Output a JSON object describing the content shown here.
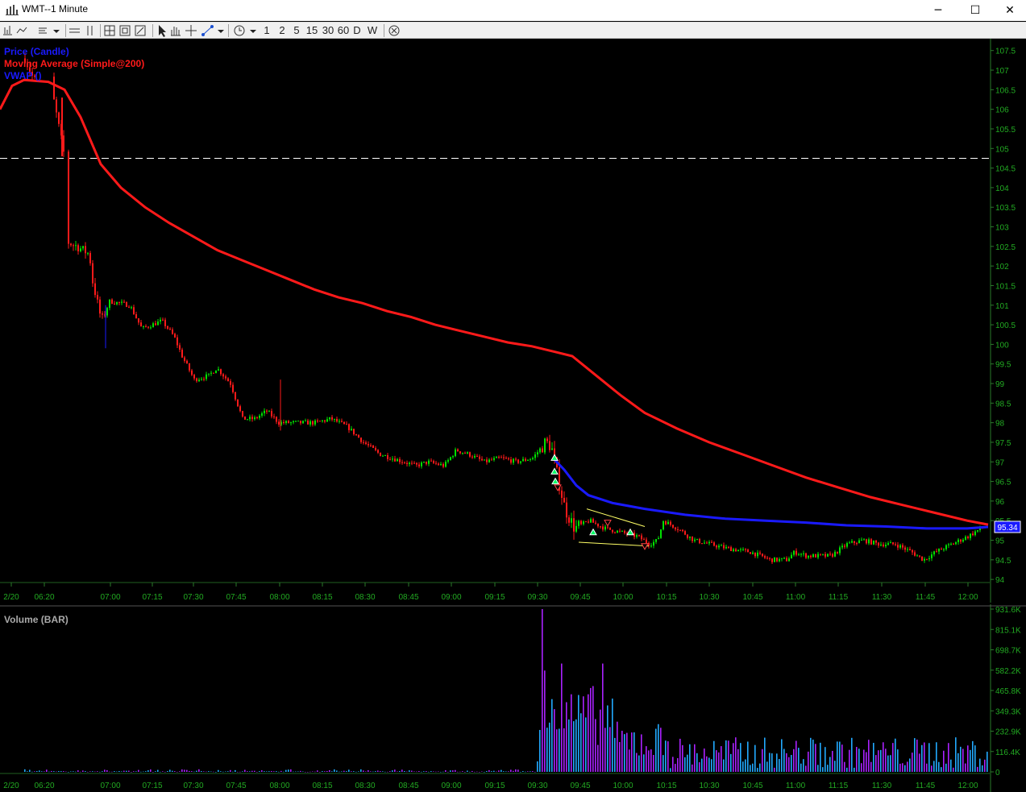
{
  "window": {
    "title": "WMT--1 Minute",
    "buttons": {
      "minimize": "─",
      "maximize": "☐",
      "close": "✕"
    }
  },
  "toolbar": {
    "icons": [
      "bar-chart-icon",
      "line-chart-icon",
      "style-icon",
      "dropdown-icon",
      "hline-icon",
      "vline-icon",
      "crosshair-box-icon",
      "zoom-box-icon",
      "zoom-fit-icon",
      "pointer-icon",
      "hand-icon",
      "crosshair-icon",
      "draw-line-icon",
      "dropdown-icon",
      "clock-icon",
      "dropdown-icon",
      "close-circle-icon"
    ],
    "intervals": [
      "1",
      "2",
      "5",
      "15",
      "30",
      "60",
      "D",
      "W"
    ]
  },
  "legend": {
    "price": "Price (Candle)",
    "ma": "Moving Average (Simple@200)",
    "vwap": "VWAP ()",
    "volume": "Volume (BAR)"
  },
  "colors": {
    "background": "#000000",
    "up_candle": "#00e000",
    "down_candle": "#ff1a1a",
    "ma": "#ff1a1a",
    "vwap": "#1a1aff",
    "axis_text": "#22aa22",
    "grid_dash": "#ffffff",
    "volume_up": "#22aaff",
    "volume_down": "#aa22ff",
    "price_label_bg": "#1a1aff",
    "triangle_up": "#00ff66",
    "triangle_down": "#ff4444",
    "channel": "#ffff66"
  },
  "chart_data": [
    {
      "type": "candlestick",
      "series": [
        {
          "name": "Price (Candle)"
        },
        {
          "name": "Moving Average (Simple@200)"
        },
        {
          "name": "VWAP ()"
        }
      ],
      "x_ticks": [
        "2/20",
        "06:20",
        "07:00",
        "07:15",
        "07:30",
        "07:45",
        "08:00",
        "08:15",
        "08:30",
        "08:45",
        "09:00",
        "09:15",
        "09:30",
        "09:45",
        "10:00",
        "10:15",
        "10:30",
        "10:45",
        "11:00",
        "11:15",
        "11:30",
        "11:45",
        "12:00"
      ],
      "y_ticks": [
        "107.5",
        "107",
        "106.5",
        "106",
        "105.5",
        "105",
        "104.5",
        "104",
        "103.5",
        "103",
        "102.5",
        "102",
        "101.5",
        "101",
        "100.5",
        "100",
        "99.5",
        "99",
        "98.5",
        "98",
        "97.5",
        "97",
        "96.5",
        "96",
        "95.5",
        "95",
        "94.5",
        "94"
      ],
      "ylim": [
        93.9,
        107.7
      ],
      "last_price_label": "95.34",
      "reference_line": 104.75,
      "ma_points": [
        [
          0,
          106.0
        ],
        [
          15,
          106.6
        ],
        [
          30,
          106.75
        ],
        [
          60,
          106.7
        ],
        [
          80,
          106.5
        ],
        [
          100,
          105.8
        ],
        [
          125,
          104.6
        ],
        [
          150,
          104.0
        ],
        [
          180,
          103.5
        ],
        [
          210,
          103.1
        ],
        [
          240,
          102.75
        ],
        [
          270,
          102.4
        ],
        [
          300,
          102.15
        ],
        [
          330,
          101.9
        ],
        [
          360,
          101.65
        ],
        [
          390,
          101.4
        ],
        [
          420,
          101.2
        ],
        [
          450,
          101.05
        ],
        [
          480,
          100.85
        ],
        [
          510,
          100.7
        ],
        [
          540,
          100.5
        ],
        [
          570,
          100.35
        ],
        [
          600,
          100.2
        ],
        [
          630,
          100.05
        ],
        [
          660,
          99.95
        ],
        [
          690,
          99.8
        ],
        [
          710,
          99.7
        ],
        [
          740,
          99.2
        ],
        [
          770,
          98.7
        ],
        [
          800,
          98.25
        ],
        [
          840,
          97.85
        ],
        [
          880,
          97.5
        ],
        [
          920,
          97.2
        ],
        [
          960,
          96.9
        ],
        [
          1000,
          96.6
        ],
        [
          1040,
          96.35
        ],
        [
          1080,
          96.1
        ],
        [
          1120,
          95.9
        ],
        [
          1160,
          95.7
        ],
        [
          1200,
          95.5
        ],
        [
          1226,
          95.4
        ]
      ],
      "vwap_points": [
        [
          686,
          97.1
        ],
        [
          700,
          96.8
        ],
        [
          715,
          96.4
        ],
        [
          730,
          96.15
        ],
        [
          760,
          95.95
        ],
        [
          800,
          95.8
        ],
        [
          850,
          95.65
        ],
        [
          900,
          95.55
        ],
        [
          950,
          95.5
        ],
        [
          1000,
          95.45
        ],
        [
          1050,
          95.38
        ],
        [
          1100,
          95.35
        ],
        [
          1150,
          95.3
        ],
        [
          1200,
          95.3
        ],
        [
          1226,
          95.34
        ]
      ],
      "volume": {
        "type": "bar",
        "name": "Volume (BAR)",
        "y_ticks": [
          "931.6K",
          "815.1K",
          "698.7K",
          "582.2K",
          "465.8K",
          "349.3K",
          "232.9K",
          "116.4K",
          "0"
        ],
        "ylim": [
          0,
          931600
        ]
      }
    }
  ]
}
